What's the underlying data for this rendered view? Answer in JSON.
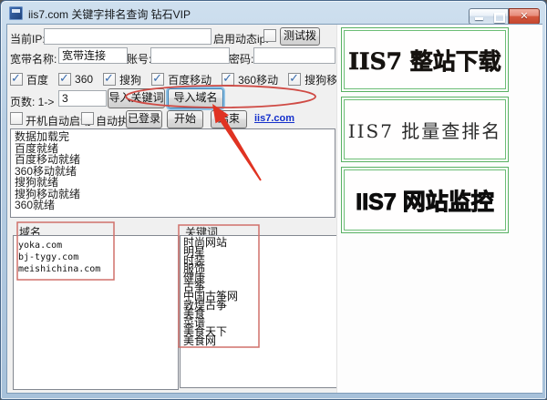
{
  "window": {
    "title": "iis7.com 关键字排名查询 钻石VIP"
  },
  "form": {
    "current_ip_label": "当前IP:",
    "current_ip_value": "",
    "dynamic_ip_label": "启用动态ip:",
    "test_dial_button": "测试拨",
    "broadband_label": "宽带名称:",
    "broadband_value": "宽带连接",
    "account_label": "账号:",
    "account_value": "",
    "password_label": "密码:",
    "password_value": "",
    "engines": [
      {
        "label": "百度",
        "checked": true
      },
      {
        "label": "360",
        "checked": true
      },
      {
        "label": "搜狗",
        "checked": true
      },
      {
        "label": "百度移动",
        "checked": true
      },
      {
        "label": "360移动",
        "checked": true
      },
      {
        "label": "搜狗移动",
        "checked": true
      }
    ],
    "pages_label": "页数: 1->",
    "pages_value": "3",
    "import_keywords_button": "导入关键词",
    "import_domains_button": "导入域名",
    "autostart_label": "开机自动启动",
    "autostart_checked": false,
    "autorun_label": "自动执行",
    "autorun_checked": false,
    "logged_in_button": "已登录",
    "start_button": "开始",
    "stop_button": "结束",
    "site_link": "iis7.com",
    "status_lines": [
      "数据加载完",
      "百度就绪",
      "百度移动就绪",
      "360移动就绪",
      "搜狗就绪",
      "搜狗移动就绪",
      "360就绪"
    ],
    "domains_label": "域名",
    "domains": [
      "yoka.com",
      "bj-tygy.com",
      "meishichina.com"
    ],
    "keywords_label": "关键词",
    "keywords": [
      "时尚网站",
      "明星",
      "时装",
      "服饰",
      "健康",
      "古筝",
      "中国古筝网",
      "敦煌古筝",
      "美食",
      "菜谱",
      "美食天下",
      "美食网"
    ]
  },
  "sidebar": {
    "banners": [
      "IIS7 整站下载",
      "IIS7 批量查排名",
      "IIS7 网站监控"
    ]
  },
  "colors": {
    "annotation_red": "#cf5a50",
    "arrow_red": "#e03322",
    "banner_green": "#58b163",
    "link_blue": "#1430cc"
  }
}
